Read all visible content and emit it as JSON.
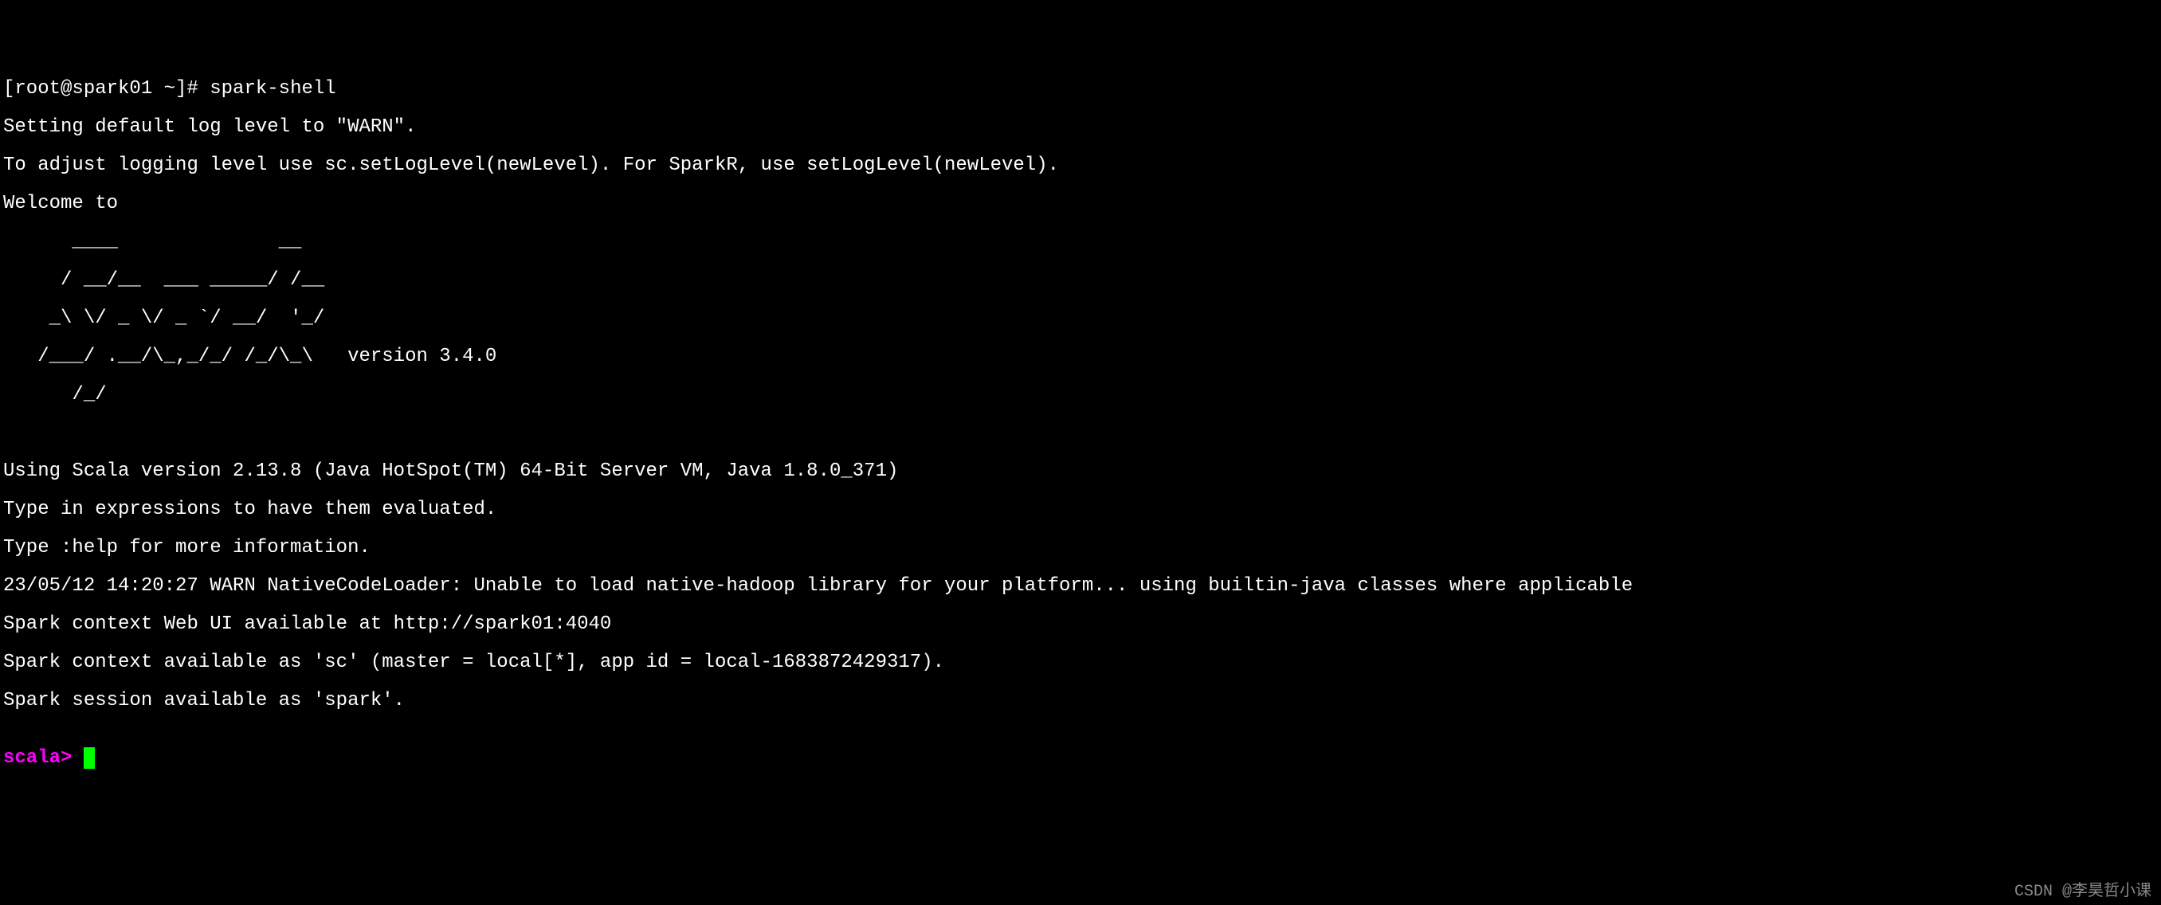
{
  "terminal": {
    "shell_prompt": "[root@spark01 ~]# ",
    "command": "spark-shell",
    "line_setting": "Setting default log level to \"WARN\".",
    "line_adjust": "To adjust logging level use sc.setLogLevel(newLevel). For SparkR, use setLogLevel(newLevel).",
    "line_welcome": "Welcome to",
    "ascii_art1": "      ____              __",
    "ascii_art2": "     / __/__  ___ _____/ /__",
    "ascii_art3": "    _\\ \\/ _ \\/ _ `/ __/  '_/",
    "ascii_art4": "   /___/ .__/\\_,_/_/ /_/\\_\\   version 3.4.0",
    "ascii_art5": "      /_/",
    "line_blank1": "                        ",
    "line_scala_version": "Using Scala version 2.13.8 (Java HotSpot(TM) 64-Bit Server VM, Java 1.8.0_371)",
    "line_type_expr": "Type in expressions to have them evaluated.",
    "line_type_help": "Type :help for more information.",
    "line_warn": "23/05/12 14:20:27 WARN NativeCodeLoader: Unable to load native-hadoop library for your platform... using builtin-java classes where applicable",
    "line_webui": "Spark context Web UI available at http://spark01:4040",
    "line_sc": "Spark context available as 'sc' (master = local[*], app id = local-1683872429317).",
    "line_session": "Spark session available as 'spark'.",
    "line_blank2": "",
    "scala_prompt": "scala> ",
    "cursor": " "
  },
  "watermark_text": "CSDN @李昊哲小课"
}
